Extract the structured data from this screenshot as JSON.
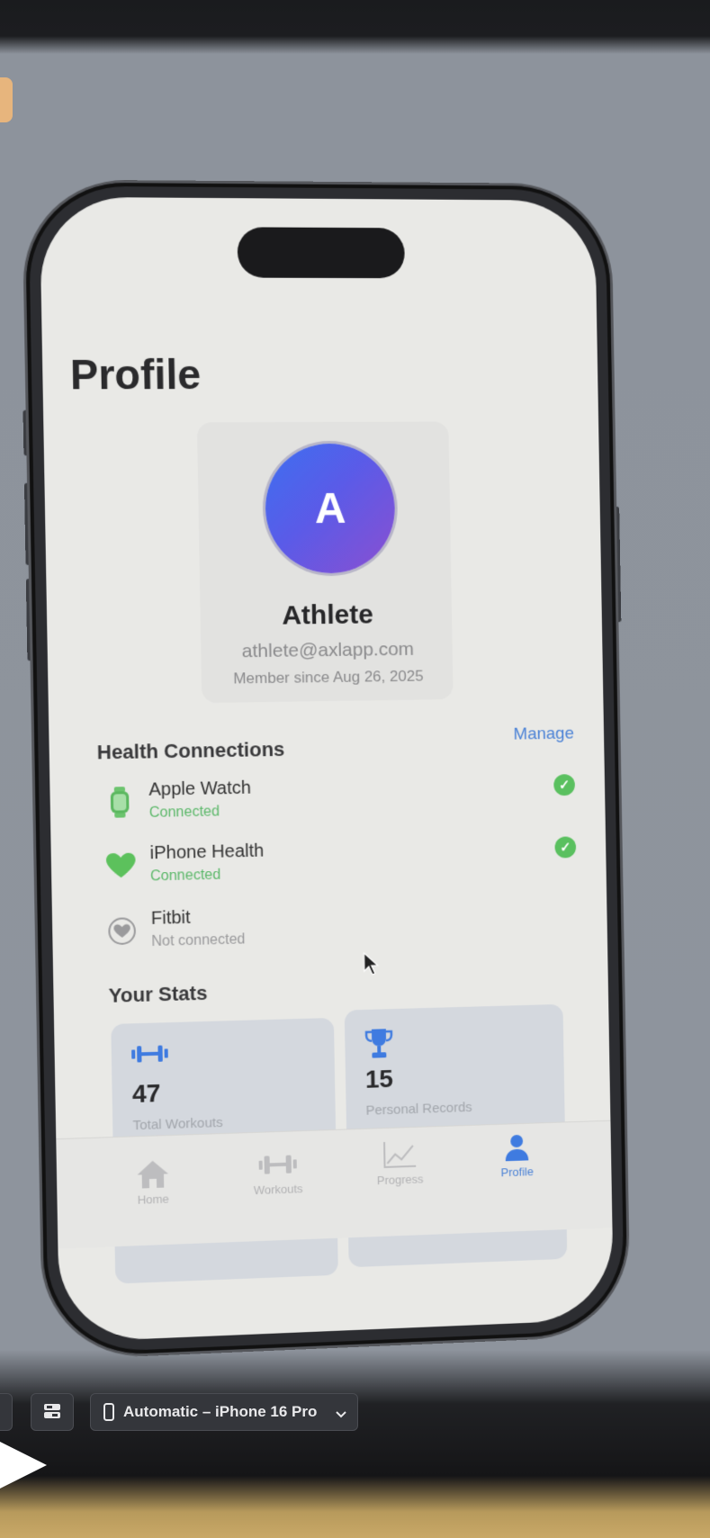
{
  "screen": {
    "title": "Profile",
    "profile": {
      "initial": "A",
      "name": "Athlete",
      "email": "athlete@axlapp.com",
      "member_since": "Member since Aug 26, 2025"
    },
    "health": {
      "heading": "Health Connections",
      "manage_label": "Manage",
      "items": [
        {
          "label": "Apple Watch",
          "status": "Connected",
          "icon": "watch-icon",
          "connected": true
        },
        {
          "label": "iPhone Health",
          "status": "Connected",
          "icon": "heart-icon",
          "connected": true
        },
        {
          "label": "Fitbit",
          "status": "Not connected",
          "icon": "heart-outline-icon",
          "connected": false
        }
      ]
    },
    "stats": {
      "heading": "Your Stats",
      "items": [
        {
          "value": "47",
          "caption": "Total Workouts",
          "icon": "dumbbell-icon"
        },
        {
          "value": "15",
          "caption": "Personal Records",
          "icon": "trophy-icon"
        },
        {
          "value": "",
          "caption": "",
          "icon": "calendar-icon"
        },
        {
          "value": "",
          "caption": "",
          "icon": "weight-icon"
        }
      ]
    },
    "tabs": [
      {
        "label": "Home",
        "icon": "home-icon",
        "active": false
      },
      {
        "label": "Workouts",
        "icon": "dumbbell-icon",
        "active": false
      },
      {
        "label": "Progress",
        "icon": "chart-icon",
        "active": false
      },
      {
        "label": "Profile",
        "icon": "person-icon",
        "active": true
      }
    ]
  },
  "toolbar": {
    "device_label": "Automatic – iPhone 16 Pro"
  },
  "colors": {
    "accent": "#4b82d6",
    "connected": "#5ac05f",
    "avatar_start": "#3d6ff0",
    "avatar_end": "#8b4fd0"
  }
}
